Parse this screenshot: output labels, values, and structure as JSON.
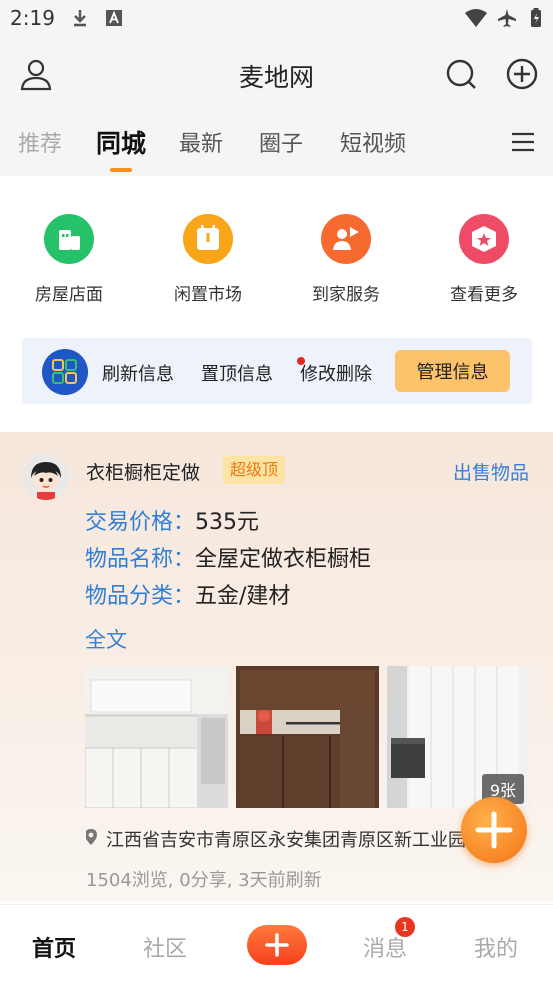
{
  "status_bar": {
    "time": "2:19"
  },
  "header": {
    "title": "麦地网"
  },
  "tabs": [
    {
      "label": "推荐"
    },
    {
      "label": "同城"
    },
    {
      "label": "最新"
    },
    {
      "label": "圈子"
    },
    {
      "label": "短视频"
    }
  ],
  "quick_links": [
    {
      "label": "房屋店面",
      "icon": "building-icon",
      "color": "#25c26a"
    },
    {
      "label": "闲置市场",
      "icon": "calendar-icon",
      "color": "#f8a51a"
    },
    {
      "label": "到家服务",
      "icon": "person-flag-icon",
      "color": "#f6692f"
    },
    {
      "label": "查看更多",
      "icon": "more-box-icon",
      "color": "#f04b66"
    }
  ],
  "manage_bar": {
    "refresh": "刷新信息",
    "pin": "置顶信息",
    "edit": "修改删除",
    "manage_button": "管理信息"
  },
  "post": {
    "title": "衣柜橱柜定做",
    "badge": "超级顶",
    "category": "出售物品",
    "fields": [
      {
        "key": "交易价格：",
        "value": "535元"
      },
      {
        "key": "物品名称：",
        "value": "全屋定做衣柜橱柜"
      },
      {
        "key": "物品分类：",
        "value": "五金/建材"
      }
    ],
    "full_text_link": "全文",
    "photo_count": "9张",
    "location": "江西省吉安市青原区永安集团青原区新工业园",
    "stats": "1504浏览, 0分享, 3天前刷新"
  },
  "bottom_nav": {
    "home": "首页",
    "community": "社区",
    "messages": "消息",
    "messages_badge": "1",
    "mine": "我的"
  },
  "colors": {
    "accent": "#f7901e",
    "link": "#3a7fd6"
  }
}
